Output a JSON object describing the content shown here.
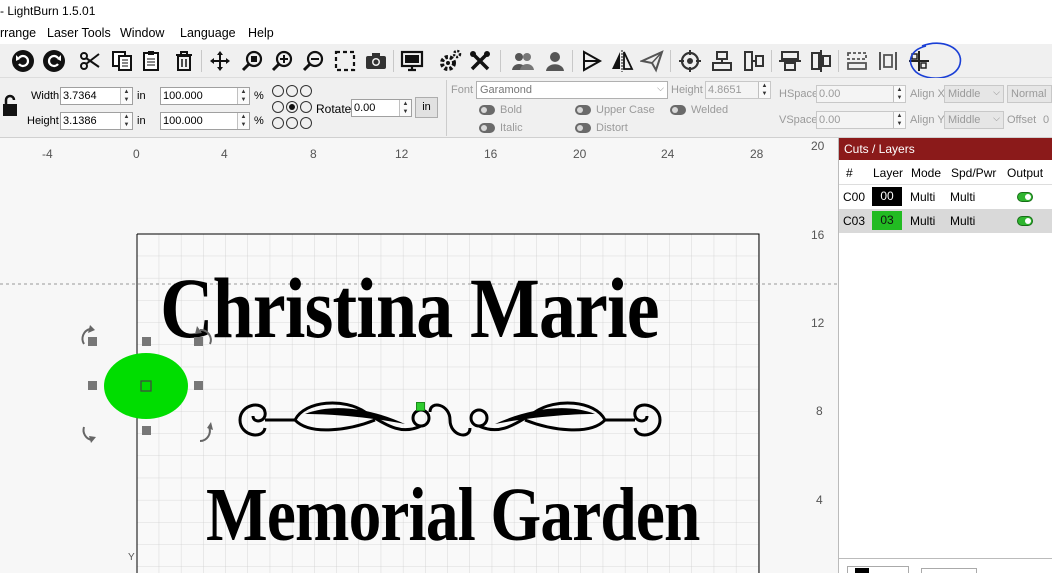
{
  "app": {
    "title": "- LightBurn 1.5.01"
  },
  "menu": [
    "rrange",
    "Laser Tools",
    "Window",
    "Language",
    "Help"
  ],
  "toolbar": {
    "icons": [
      "undo-icon",
      "redo-icon",
      "cut-icon",
      "copy-icon",
      "paste-icon",
      "delete-icon",
      "move-icon",
      "zoom-page-icon",
      "zoom-in-icon",
      "zoom-out-icon",
      "select-frame-icon",
      "camera-icon",
      "monitor-icon",
      "settings-icon",
      "tools-icon",
      "group-icon",
      "ungroup-icon",
      "flip-horizontal-icon",
      "mirror-icon",
      "send-icon",
      "target-icon",
      "align-icons",
      "distribute-icons",
      "align-center-icon"
    ]
  },
  "props": {
    "width_label": "Width",
    "width_value": "3.7364",
    "width_unit": "in",
    "height_label": "Height",
    "height_value": "3.1386",
    "height_unit": "in",
    "scale_w": "100.000",
    "scale_h": "100.000",
    "pct": "%",
    "rotate_label": "Rotate",
    "rotate_value": "0.00",
    "in_button": "in",
    "font_label": "Font",
    "font_value": "Garamond",
    "height2_label": "Height",
    "height2_value": "4.8651",
    "bold": "Bold",
    "italic": "Italic",
    "upper": "Upper Case",
    "distort": "Distort",
    "welded": "Welded",
    "hspace_label": "HSpace",
    "hspace_value": "0.00",
    "vspace_label": "VSpace",
    "vspace_value": "0.00",
    "alignx_label": "Align X",
    "alignx_value": "Middle",
    "aligny_label": "Align Y",
    "aligny_value": "Middle",
    "normal_value": "Normal",
    "offset_label": "Offset",
    "offset_value": "0"
  },
  "rulers": {
    "top": [
      "-4",
      "0",
      "4",
      "8",
      "12",
      "16",
      "20",
      "24",
      "28"
    ],
    "right": [
      "20",
      "16",
      "12",
      "8",
      "4"
    ],
    "y_label": "Y"
  },
  "design": {
    "line1": "Christina Marie",
    "line2": "Memorial Garden"
  },
  "panel": {
    "title": "Cuts / Layers",
    "headers": [
      "#",
      "Layer",
      "Mode",
      "Spd/Pwr",
      "Output"
    ],
    "rows": [
      {
        "num": "C00",
        "layer": "00",
        "mode": "Multi",
        "spdpwr": "Multi",
        "color": "#000000"
      },
      {
        "num": "C03",
        "layer": "03",
        "mode": "Multi",
        "spdpwr": "Multi",
        "color": "#22bb22"
      }
    ]
  },
  "colors": {
    "accent_panel": "#8b1a1a",
    "selection_fill": "#00dd00"
  }
}
